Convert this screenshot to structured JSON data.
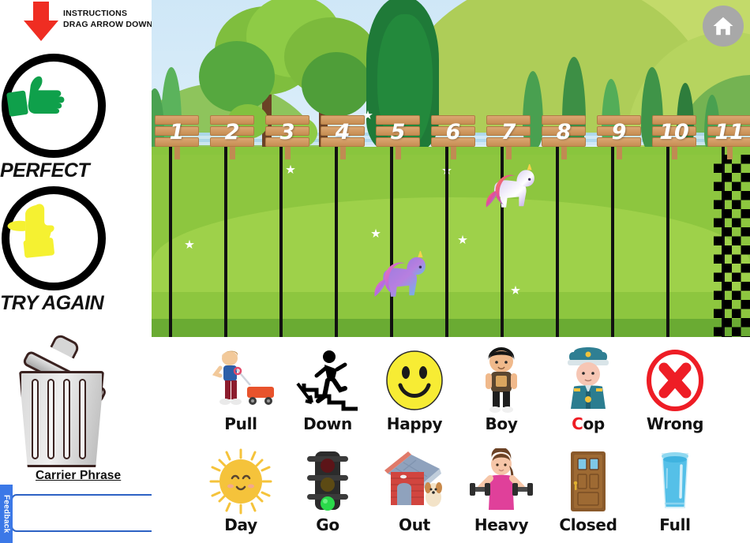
{
  "instructions": {
    "line1": "INSTRUCTIONS",
    "line2": "DRAG ARROW DOWN",
    "arrow_icon": "arrow-down-icon",
    "arrow_color": "#ef2d22"
  },
  "sidebar": {
    "status_buttons": [
      {
        "label": "PERFECT",
        "icon": "thumbs-up-icon",
        "color": "#0fa04b"
      },
      {
        "label": "TRY AGAIN",
        "icon": "thumbs-sideways-icon",
        "color": "#f5f131"
      }
    ],
    "trash": {
      "icon": "trash-can-icon",
      "label": ""
    },
    "carrier_phrase": {
      "label": "Carrier Phrase",
      "value": "",
      "placeholder": ""
    },
    "feedback_tab": {
      "label": "Feedback"
    }
  },
  "field": {
    "home_button": {
      "icon": "home-icon",
      "label": ""
    },
    "lane_numbers": [
      "1",
      "2",
      "3",
      "4",
      "5",
      "6",
      "7",
      "8",
      "9",
      "10",
      "11"
    ],
    "finish_line": "checkered-finish-line",
    "players": [
      {
        "name": "unicorn-player-1",
        "lane": 5,
        "progress_number": 5
      },
      {
        "name": "unicorn-player-2",
        "lane": 7,
        "progress_number": 7
      }
    ]
  },
  "cards": {
    "row1": [
      {
        "label": "Pull",
        "icon": "boy-pulling-wagon-icon"
      },
      {
        "label": "Down",
        "icon": "person-walking-down-stairs-icon"
      },
      {
        "label": "Happy",
        "icon": "smiley-face-icon"
      },
      {
        "label": "Boy",
        "icon": "boy-icon"
      },
      {
        "label": "Cop",
        "icon": "police-officer-icon",
        "highlight_first_letter": true,
        "highlight_color": "#ee1d25"
      },
      {
        "label": "Wrong",
        "icon": "red-x-circle-icon"
      }
    ],
    "row2": [
      {
        "label": "Day",
        "icon": "sun-icon"
      },
      {
        "label": "Go",
        "icon": "traffic-light-green-icon"
      },
      {
        "label": "Out",
        "icon": "doghouse-with-dog-icon"
      },
      {
        "label": "Heavy",
        "icon": "woman-lifting-dumbbells-icon"
      },
      {
        "label": "Closed",
        "icon": "closed-door-icon"
      },
      {
        "label": "Full",
        "icon": "full-glass-of-water-icon"
      }
    ]
  }
}
